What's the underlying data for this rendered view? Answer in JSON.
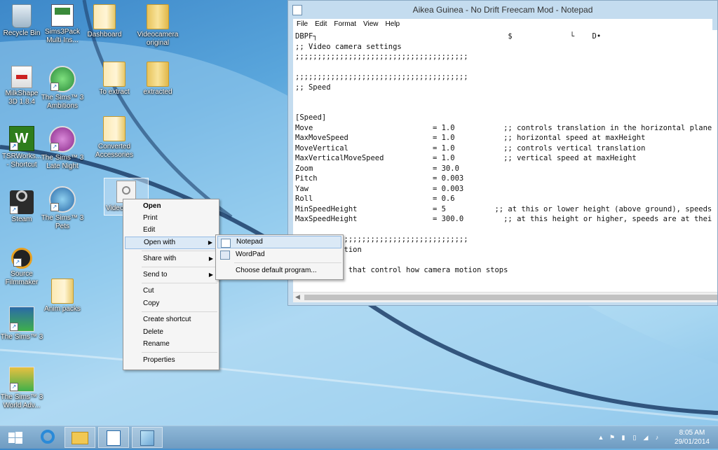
{
  "desktop": {
    "icons": [
      {
        "label": "Recycle Bin"
      },
      {
        "label": "Sims3Pack Multi Ins..."
      },
      {
        "label": "Dashboard"
      },
      {
        "label": "Videocamera original"
      },
      {
        "label": "To extract"
      },
      {
        "label": "extracted"
      },
      {
        "label": "MilkShape 3D 1.8.4"
      },
      {
        "label": "The Sims™ 3 Ambitions"
      },
      {
        "label": "TSRWorks... - Shortcut"
      },
      {
        "label": "The Sims™ 3 Late Night"
      },
      {
        "label": "Converted Accessories"
      },
      {
        "label": "Steam"
      },
      {
        "label": "The Sims™ 3 Pets"
      },
      {
        "label": "Video"
      },
      {
        "label": "Source Filmmaker"
      },
      {
        "label": "Anim packs"
      },
      {
        "label": "The Sims™ 3"
      },
      {
        "label": "The Sims™ 3 World Adv..."
      }
    ]
  },
  "notepad": {
    "title": "Aikea Guinea - No Drift Freecam Mod - Notepad",
    "menu": [
      "File",
      "Edit",
      "Format",
      "View",
      "Help"
    ],
    "content": "DBPF┐                                           $             └    D•\n;; Video camera settings\n;;;;;;;;;;;;;;;;;;;;;;;;;;;;;;;;;;;;;;;\n\n;;;;;;;;;;;;;;;;;;;;;;;;;;;;;;;;;;;;;;;\n;; Speed\n\n\n[Speed]\nMove                           = 1.0           ;; controls translation in the horizontal plane\nMaxMoveSpeed                   = 1.0           ;; horizontal speed at maxHeight\nMoveVertical                   = 1.0           ;; controls vertical translation\nMaxVerticalMoveSpeed           = 1.0           ;; vertical speed at maxHeight\nZoom                           = 30.0\nPitch                          = 0.003\nYaw                            = 0.003\nRoll                           = 0.6\nMinSpeedHeight                 = 5           ;; at this or lower height (above ground), speeds\nMaxSpeedHeight                 = 300.0         ;; at this height or higher, speeds are at thei\n\n;;;;;;;;;;;;;;;;;;;;;;;;;;;;;;;;;;;;;;;\n;; Deceleration\n\n;; settings that control how camera motion stops"
  },
  "context_menu": {
    "items": [
      "Open",
      "Print",
      "Edit",
      "Open with",
      "Share with",
      "Send to",
      "Cut",
      "Copy",
      "Create shortcut",
      "Delete",
      "Rename",
      "Properties"
    ]
  },
  "open_with_menu": {
    "items": [
      "Notepad",
      "WordPad",
      "Choose default program..."
    ]
  },
  "taskbar": {
    "time": "8:05 AM",
    "date": "29/01/2014"
  },
  "colors": {
    "accent": "#96bce4",
    "taskbar": "#7aa6cc"
  }
}
